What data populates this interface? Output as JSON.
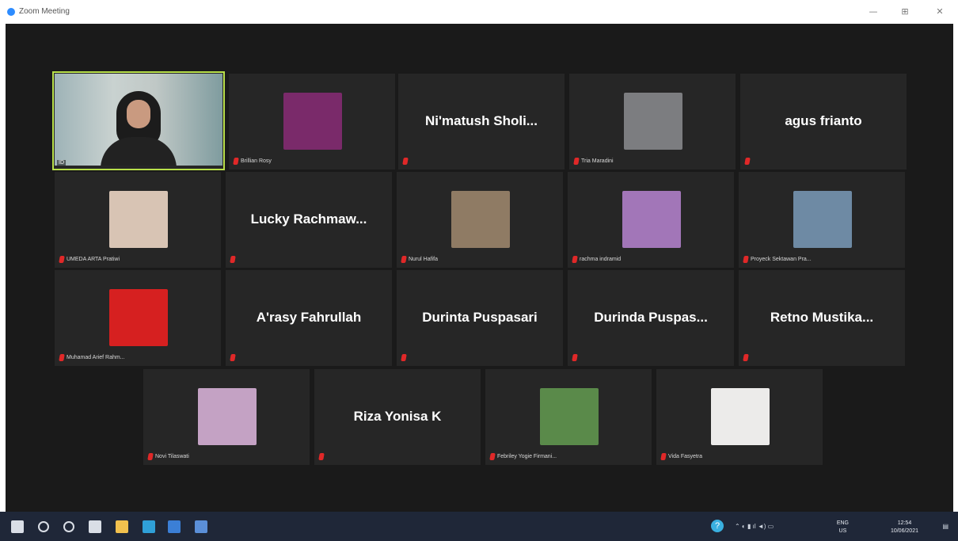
{
  "window": {
    "title": "Zoom Meeting",
    "minimize": "—",
    "restore": "⊞",
    "close": "✕"
  },
  "self_view": {
    "label": "ID"
  },
  "participants": [
    {
      "name": "Brillian Rosy",
      "display": "photo",
      "photo_color": "#7a2a6a"
    },
    {
      "name": "Ni'matush Sholi...",
      "display": "name"
    },
    {
      "name": "Tria Maradini",
      "display": "photo",
      "photo_color": "#7c7d80"
    },
    {
      "name": "agus frianto",
      "display": "name"
    },
    {
      "name": "UMEDA ARTA Pratiwi",
      "display": "photo",
      "photo_color": "#d8c4b4"
    },
    {
      "name": "Lucky Rachmaw...",
      "display": "name"
    },
    {
      "name": "Nurul Hafifa",
      "display": "photo",
      "photo_color": "#8f7b64"
    },
    {
      "name": "rachma indramid",
      "display": "photo",
      "photo_color": "#a276b8"
    },
    {
      "name": "Proyeck Sektawan Pra...",
      "display": "photo",
      "photo_color": "#6e8aa4"
    },
    {
      "name": "Muhamad Arief Rahm...",
      "display": "photo",
      "photo_color": "#d62020"
    },
    {
      "name": "A'rasy Fahrullah",
      "display": "name"
    },
    {
      "name": "Durinta Puspasari",
      "display": "name"
    },
    {
      "name": "Durinda Puspas...",
      "display": "name"
    },
    {
      "name": "Retno Mustika...",
      "display": "name"
    },
    {
      "name": "Novi Tilaswati",
      "display": "photo",
      "photo_color": "#c4a2c4"
    },
    {
      "name": "Riza Yonisa K",
      "display": "name"
    },
    {
      "name": "Febriley Yogie Firmani...",
      "display": "photo",
      "photo_color": "#5a8a4a"
    },
    {
      "name": "Vida Fasyetra",
      "display": "photo",
      "photo_color": "#ecebea"
    }
  ],
  "taskbar": {
    "apps": [
      {
        "icon": "windows-start-icon",
        "color": "#d9dee6"
      },
      {
        "icon": "search-icon",
        "color": "#d9dee6"
      },
      {
        "icon": "cortana-icon",
        "color": "#d9dee6"
      },
      {
        "icon": "task-view-icon",
        "color": "#d9dee6"
      },
      {
        "icon": "file-explorer-icon",
        "color": "#f2c14e"
      },
      {
        "icon": "edge-icon",
        "color": "#2fa0d8"
      },
      {
        "icon": "store-icon",
        "color": "#3b7fd6"
      },
      {
        "icon": "zoom-app-icon",
        "color": "#5b8fd8"
      }
    ],
    "tray_language": "ENG",
    "tray_region": "US",
    "time": "12:54",
    "date": "10/06/2021"
  }
}
